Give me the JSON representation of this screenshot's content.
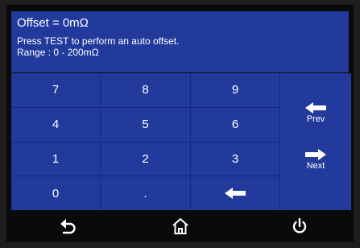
{
  "header": {
    "title": "Offset = 0mΩ",
    "instruction": "Press TEST to perform an auto offset.",
    "range": "Range : 0 - 200mΩ"
  },
  "keypad": {
    "k7": "7",
    "k8": "8",
    "k9": "9",
    "k4": "4",
    "k5": "5",
    "k6": "6",
    "k1": "1",
    "k2": "2",
    "k3": "3",
    "k0": "0",
    "dot": "."
  },
  "side": {
    "prev_label": "Prev",
    "next_label": "Next"
  },
  "icons": {
    "backspace": "left-arrow-icon",
    "prev": "left-arrow-icon",
    "next": "right-arrow-icon",
    "back": "undo-arrow-icon",
    "home": "home-icon",
    "power": "power-icon"
  },
  "colors": {
    "panel": "#213a9c",
    "grid_lines": "#14297a",
    "background": "#0a0a0a",
    "text": "#ffffff"
  }
}
